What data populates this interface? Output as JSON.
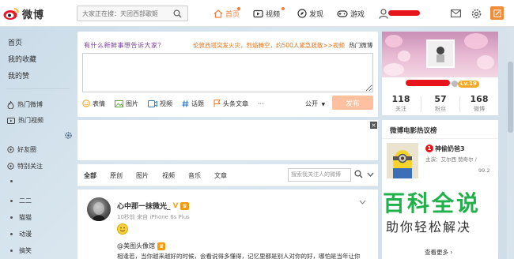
{
  "app": {
    "logo_text": "微博"
  },
  "search": {
    "placeholder": "大家正在搜：天团西部歌姬"
  },
  "topnav": {
    "home": "首页",
    "video": "视频",
    "discover": "发现",
    "game": "游戏"
  },
  "leftnav": {
    "main": [
      "首页",
      "我的收藏",
      "我的赞"
    ],
    "hot": [
      "热门微博",
      "热门视频"
    ],
    "groups": [
      "好友圈",
      "特别关注"
    ],
    "items": [
      "",
      "二二",
      "猫猫",
      "动漫",
      "搞笑"
    ]
  },
  "publisher": {
    "hint": "有什么新鲜事想告诉大家？",
    "hot_topic": "伦敦西塔突发火灾，烈焰腾空，约500人紧急疏散>>视频",
    "hot_link": "热门微博",
    "tools": [
      "表情",
      "图片",
      "视频",
      "话题",
      "头条文章",
      "···"
    ],
    "visibility": "公开",
    "submit": "发布"
  },
  "feed_tabs": {
    "tabs": [
      "全部",
      "原创",
      "图片",
      "视频",
      "音乐",
      "文章"
    ],
    "search_placeholder": "搜索我关注人的微博"
  },
  "feed_card": {
    "name": "心中那一抹微光_",
    "meta": "10秒前 来自 iPhone 6s Plus",
    "mention": "@美图头像馆",
    "text": "相逢若，当你越来越好的时候，会看说得多懂得，记忆里都是别人对你的好，哪怕是当年让你"
  },
  "profile": {
    "level": "Lv.19",
    "stats": [
      {
        "num": "118",
        "label": "关注"
      },
      {
        "num": "57",
        "label": "粉丝"
      },
      {
        "num": "168",
        "label": "微博"
      }
    ]
  },
  "hot_movies": {
    "title": "微博电影热议榜",
    "rank": "1",
    "movie": "神偷奶爸3",
    "stars": "主演：艾尔西 赞奇尔 /",
    "score": "99.2",
    "more": "查看更多"
  },
  "watermark": {
    "big": "百科全说",
    "small": "助你轻松解决"
  },
  "colors": {
    "accent_orange": "#fa7d3c",
    "watermark_green": "#21b14b",
    "redaction_red": "#e8141b"
  }
}
